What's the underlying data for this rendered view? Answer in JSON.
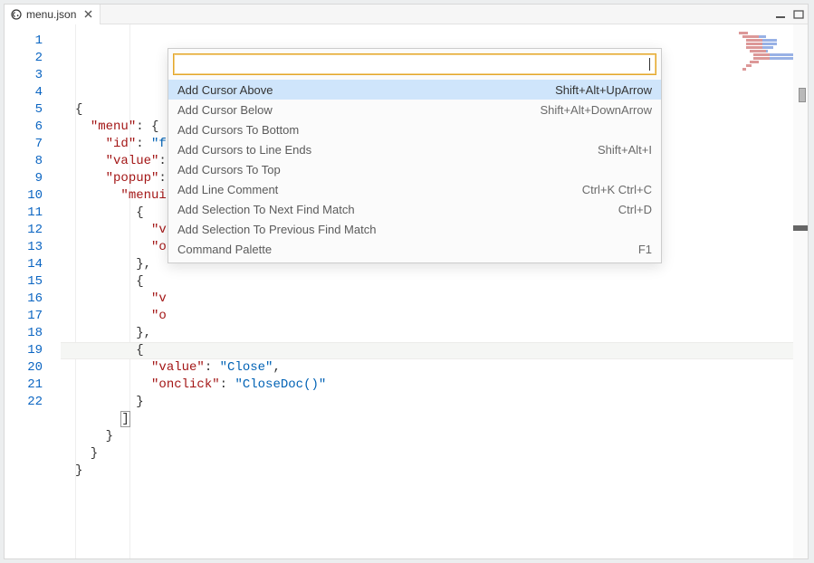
{
  "tab": {
    "title": "menu.json"
  },
  "window_icons": {
    "minimize": "min",
    "maximize": "max"
  },
  "editor": {
    "line_count": 22,
    "cursor_line": 19,
    "tokens": [
      [
        {
          "t": "{",
          "c": "punct"
        }
      ],
      [
        {
          "t": "  ",
          "c": "punct"
        },
        {
          "t": "\"menu\"",
          "c": "key"
        },
        {
          "t": ": {",
          "c": "punct"
        }
      ],
      [
        {
          "t": "    ",
          "c": "punct"
        },
        {
          "t": "\"id\"",
          "c": "key"
        },
        {
          "t": ": ",
          "c": "punct"
        },
        {
          "t": "\"f",
          "c": "str"
        }
      ],
      [
        {
          "t": "    ",
          "c": "punct"
        },
        {
          "t": "\"value\"",
          "c": "key"
        },
        {
          "t": ":",
          "c": "punct"
        }
      ],
      [
        {
          "t": "    ",
          "c": "punct"
        },
        {
          "t": "\"popup\"",
          "c": "key"
        },
        {
          "t": ":",
          "c": "punct"
        }
      ],
      [
        {
          "t": "      ",
          "c": "punct"
        },
        {
          "t": "\"menui",
          "c": "key"
        }
      ],
      [
        {
          "t": "        {",
          "c": "punct"
        }
      ],
      [
        {
          "t": "          ",
          "c": "punct"
        },
        {
          "t": "\"v",
          "c": "key"
        }
      ],
      [
        {
          "t": "          ",
          "c": "punct"
        },
        {
          "t": "\"o",
          "c": "key"
        }
      ],
      [
        {
          "t": "        },",
          "c": "punct"
        }
      ],
      [
        {
          "t": "        {",
          "c": "punct"
        }
      ],
      [
        {
          "t": "          ",
          "c": "punct"
        },
        {
          "t": "\"v",
          "c": "key"
        }
      ],
      [
        {
          "t": "          ",
          "c": "punct"
        },
        {
          "t": "\"o",
          "c": "key"
        }
      ],
      [
        {
          "t": "        },",
          "c": "punct"
        }
      ],
      [
        {
          "t": "        {",
          "c": "punct"
        }
      ],
      [
        {
          "t": "          ",
          "c": "punct"
        },
        {
          "t": "\"value\"",
          "c": "key"
        },
        {
          "t": ": ",
          "c": "punct"
        },
        {
          "t": "\"Close\"",
          "c": "str"
        },
        {
          "t": ",",
          "c": "punct"
        }
      ],
      [
        {
          "t": "          ",
          "c": "punct"
        },
        {
          "t": "\"onclick\"",
          "c": "key"
        },
        {
          "t": ": ",
          "c": "punct"
        },
        {
          "t": "\"CloseDoc()\"",
          "c": "str"
        }
      ],
      [
        {
          "t": "        }",
          "c": "punct"
        }
      ],
      [
        {
          "t": "      ",
          "c": "punct"
        },
        {
          "t": "]",
          "c": "punct bracket-hl"
        }
      ],
      [
        {
          "t": "    }",
          "c": "punct"
        }
      ],
      [
        {
          "t": "  }",
          "c": "punct"
        }
      ],
      [
        {
          "t": "}",
          "c": "punct"
        }
      ]
    ]
  },
  "palette": {
    "input_value": "",
    "placeholder": "",
    "selected_index": 0,
    "items": [
      {
        "label": "Add Cursor Above",
        "shortcut": "Shift+Alt+UpArrow"
      },
      {
        "label": "Add Cursor Below",
        "shortcut": "Shift+Alt+DownArrow"
      },
      {
        "label": "Add Cursors To Bottom",
        "shortcut": ""
      },
      {
        "label": "Add Cursors to Line Ends",
        "shortcut": "Shift+Alt+I"
      },
      {
        "label": "Add Cursors To Top",
        "shortcut": ""
      },
      {
        "label": "Add Line Comment",
        "shortcut": "Ctrl+K Ctrl+C"
      },
      {
        "label": "Add Selection To Next Find Match",
        "shortcut": "Ctrl+D"
      },
      {
        "label": "Add Selection To Previous Find Match",
        "shortcut": ""
      },
      {
        "label": "Command Palette",
        "shortcut": "F1"
      }
    ]
  }
}
